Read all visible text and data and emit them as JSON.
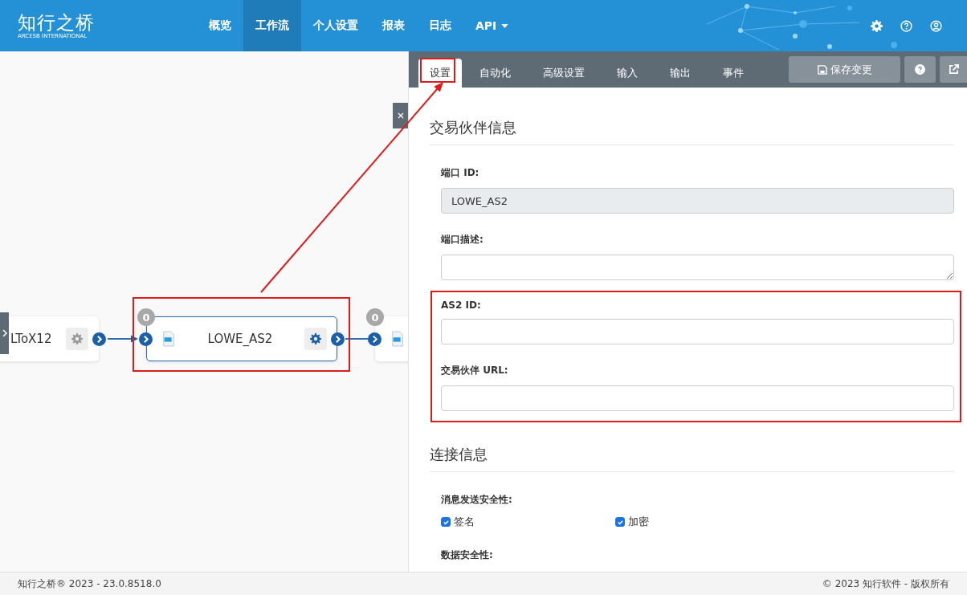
{
  "logo": {
    "name": "知行之桥",
    "tagline": "ARCESB INTERNATIONAL"
  },
  "nav": [
    {
      "label": "概览",
      "selected": false,
      "dropdown": false
    },
    {
      "label": "工作流",
      "selected": true,
      "dropdown": false
    },
    {
      "label": "个人设置",
      "selected": false,
      "dropdown": false
    },
    {
      "label": "报表",
      "selected": false,
      "dropdown": false
    },
    {
      "label": "日志",
      "selected": false,
      "dropdown": false
    },
    {
      "label": "API",
      "selected": false,
      "dropdown": true
    }
  ],
  "canvas": {
    "nodes": [
      {
        "label": "LToX12",
        "selected": false
      },
      {
        "label": "LOWE_AS2",
        "badge": "0",
        "selected": true
      },
      {
        "badge": "0",
        "selected": false
      }
    ]
  },
  "tabs": [
    {
      "label": "设置",
      "selected": true
    },
    {
      "label": "自动化",
      "selected": false
    },
    {
      "label": "高级设置",
      "selected": false
    },
    {
      "label": "输入",
      "selected": false
    },
    {
      "label": "输出",
      "selected": false
    },
    {
      "label": "事件",
      "selected": false
    }
  ],
  "save_button": "保存变更",
  "sections": [
    {
      "title": "交易伙伴信息",
      "fields": [
        {
          "kind": "text",
          "label": "端口 ID:",
          "value": "LOWE_AS2",
          "disabled": true
        },
        {
          "kind": "textarea",
          "label": "端口描述:",
          "disabled": false
        },
        {
          "kind": "text",
          "label": "AS2 ID:",
          "disabled": false
        },
        {
          "kind": "text",
          "label": "交易伙伴 URL:",
          "disabled": false
        }
      ]
    },
    {
      "title": "连接信息",
      "fields": [
        {
          "kind": "checkboxes",
          "label": "消息发送安全性:",
          "options": [
            {
              "label": "签名",
              "checked": true
            },
            {
              "label": "加密",
              "checked": true
            }
          ]
        },
        {
          "kind": "heading",
          "label": "数据安全性:"
        }
      ]
    }
  ],
  "footer": {
    "left": "知行之桥® 2023 - 23.0.8518.0",
    "right": "© 2023 知行软件 - 版权所有"
  }
}
